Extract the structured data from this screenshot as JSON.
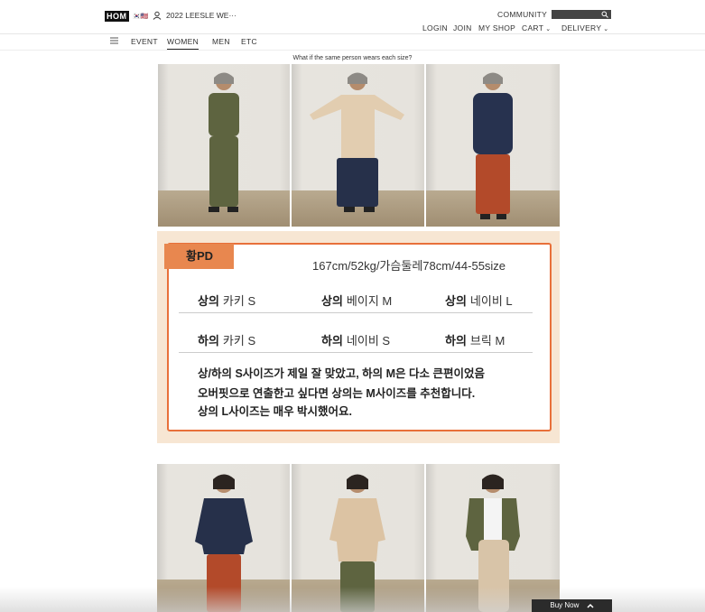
{
  "header": {
    "logo": "HOM",
    "flag": "🇰🇷🇺🇸",
    "promo": "2022 LEESLE WE···",
    "community": "COMMUNITY",
    "nav": [
      {
        "label": "LOGIN",
        "chevron": ""
      },
      {
        "label": "JOIN",
        "chevron": ""
      },
      {
        "label": "MY SHOP",
        "chevron": ""
      },
      {
        "label": "CART",
        "chevron": "⌄"
      },
      {
        "label": "DELIVERY",
        "chevron": "⌄"
      }
    ],
    "categories": [
      "EVENT",
      "WOMEN",
      "MEN",
      "ETC"
    ],
    "active_category": "WOMEN"
  },
  "main": {
    "caption": "What if the same person wears each size?",
    "top_photos": [
      {
        "top_color": "#5e6440",
        "bottom_color": "#5e6440"
      },
      {
        "top_color": "#e2cdb0",
        "bottom_color": "#26304a"
      },
      {
        "top_color": "#27324f",
        "bottom_color": "#b34a2a"
      }
    ],
    "card": {
      "name": "황PD",
      "spec": "167cm/52kg/가슴둘레78cm/44-55size",
      "rows": [
        [
          {
            "part": "상의",
            "value": "카키 S"
          },
          {
            "part": "상의",
            "value": "베이지 M"
          },
          {
            "part": "상의",
            "value": "네이비 L"
          }
        ],
        [
          {
            "part": "하의",
            "value": "카키 S"
          },
          {
            "part": "하의",
            "value": "네이비 S"
          },
          {
            "part": "하의",
            "value": "브릭 M"
          }
        ]
      ],
      "note_lines": [
        "상/하의 S사이즈가 제일 잘 맞았고, 하의 M은 다소 큰편이었음",
        "오버핏으로 연출한고 싶다면 상의는 M사이즈를 추천합니다.",
        "상의 L사이즈는 매우 박시했어요."
      ]
    },
    "bottom_photos": [
      {
        "top_color": "#26304a",
        "bottom_color": "#b34a2a"
      },
      {
        "top_color": "#dcc3a3",
        "bottom_color": "#5e6440"
      },
      {
        "top_color": "#5e6440",
        "bottom_color": "#d8c4a8"
      }
    ]
  },
  "buy_now": {
    "label": "Buy Now",
    "icon": "chevron-up-icon"
  }
}
